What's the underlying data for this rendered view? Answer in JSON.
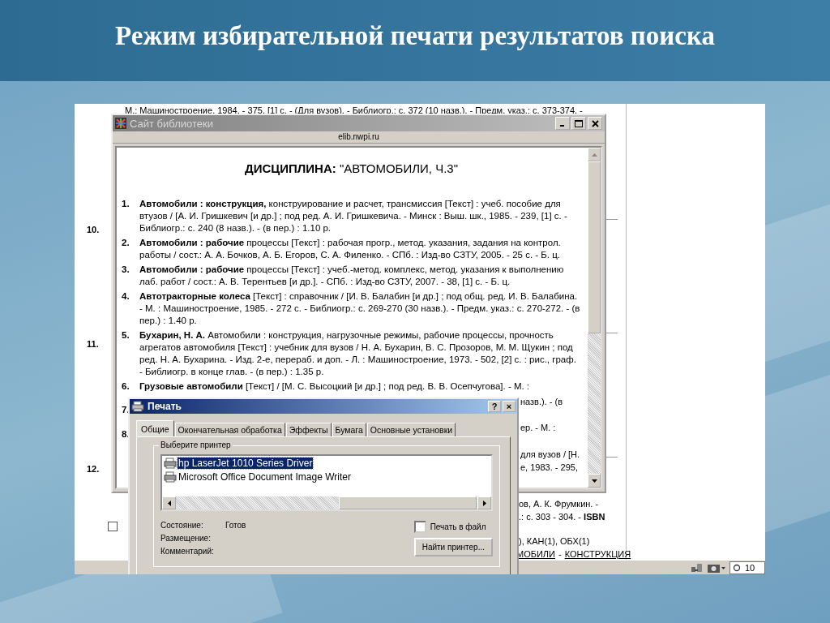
{
  "slide": {
    "title": "Режим избирательной печати результатов поиска"
  },
  "background_page": {
    "top_line": "М.: Машиностроение, 1984. - 375, [1] с. - (Для вузов). - Библиогр.: с. 372 (10 назв.). - Предм. указ.: с. 373-374. -",
    "row_numbers": [
      "10.",
      "11.",
      "12."
    ],
    "checkbox": {
      "checked": false
    },
    "fragments": [
      "ов, А. К. Фрумкин. -",
      ".: с. 303 - 304. - **ISBN**",
      "), КАН(1), ОБХ(1)"
    ],
    "links": [
      "МОБИЛИ",
      "КОНСТРУКЦИЯ"
    ],
    "link_separator": "-",
    "zoom": "10"
  },
  "browser_window": {
    "fragments": [
      "назв.). - (в",
      "ер. - М. :",
      "для вузов / [Н.",
      "е, 1983. - 295,"
    ],
    "title": "Сайт библиотеки",
    "address": "elib.nwpi.ru",
    "heading_label": "ДИСЦИПЛИНА:",
    "heading_value": "\"АВТОМОБИЛИ, Ч.3\"",
    "items": [
      {
        "number": "1.",
        "text": "**Автомобили : конструкция,** конструирование и расчет, трансмиссия [Текст] : учеб. пособие для втузов / [А. И. Гришкевич [и др.] ; под ред. А. И. Гришкевича. - Минск : Выш. шк., 1985. - 239, [1] с. - Библиогр.: с. 240 (8 назв.). - (в пер.) : 1.10 р."
      },
      {
        "number": "2.",
        "text": "**Автомобили : рабочие** процессы [Текст] : рабочая прогр., метод. указания, задания на контрол. работы / сост.: А. А. Бочков, А. Б. Егоров, С. А. Филенко. - СПб. : Изд-во СЗТУ, 2005. - 25 с. - Б. ц."
      },
      {
        "number": "3.",
        "text": "**Автомобили : рабочие** процессы [Текст] : учеб.-метод. комплекс, метод. указания к выполнению лаб. работ / сост.: А. В. Терентьев [и др.]. - СПб. : Изд-во СЗТУ, 2007. - 38, [1] с. - Б. ц."
      },
      {
        "number": "4.",
        "text": "**Автотракторные колеса** [Текст] : справочник / [И. В. Балабин [и др.] ; под общ. ред. И. В. Балабина. - М. : Машиностроение, 1985. - 272 с. - Библиогр.: с. 269-270 (30 назв.). - Предм. указ.: с. 270-272. - (в пер.) : 1.40 р."
      },
      {
        "number": "5.",
        "text": "**Бухарин, Н. А.** Автомобили : конструкция, нагрузочные режимы, рабочие процессы, прочность агрегатов автомобиля [Текст] : учебник для вузов / Н. А. Бухарин, В. С. Прозоров, М. М. Щукин ; под ред. Н. А. Бухарина. - Изд. 2-е, перераб. и доп. - Л. : Машиностроение, 1973. - 502, [2] с. : рис., граф. - Библиогр. в конце глав. - (в пер.) : 1.35 р."
      },
      {
        "number": "6.",
        "text": "**Грузовые автомобили** [Текст] / [М. С. Высоцкий [и др.] ; под ред. В. В. Осепчугова]. - М. :"
      },
      {
        "number": "7."
      },
      {
        "number": "8."
      }
    ]
  },
  "print_dialog": {
    "title": "Печать",
    "help_button": "?",
    "close_button": "×",
    "tabs": [
      {
        "label": "Общие",
        "selected": true
      },
      {
        "label": "Окончательная обработка",
        "selected": false
      },
      {
        "label": "Эффекты",
        "selected": false
      },
      {
        "label": "Бумага",
        "selected": false
      },
      {
        "label": "Основные установки",
        "selected": false
      }
    ],
    "group_label": "Выберите принтер",
    "printers": [
      {
        "name": "hp LaserJet 1010 Series Driver",
        "selected": true
      },
      {
        "name": "Microsoft Office Document Image Writer",
        "selected": false
      }
    ],
    "info": [
      {
        "label": "Состояние:",
        "value": "Готов"
      },
      {
        "label": "Размещение:"
      },
      {
        "label": "Комментарий:"
      }
    ],
    "print_to_file": {
      "label": "Печать в файл",
      "checked": false
    },
    "find_button": "Найти принтер..."
  }
}
